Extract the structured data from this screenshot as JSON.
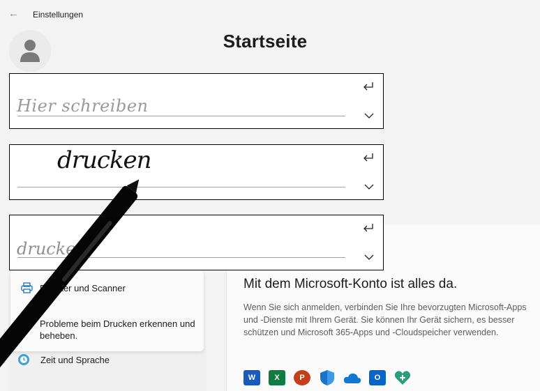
{
  "window": {
    "title": "Einstellungen"
  },
  "page": {
    "title": "Startseite"
  },
  "handwriting": {
    "placeholder": "Hier schreiben",
    "ink_text": "drucken",
    "suggestion": "drucken"
  },
  "nav_popup": {
    "items": [
      {
        "label": "Drucker und Scanner",
        "icon": "printer-icon"
      },
      {
        "label": "Probleme beim Drucken erkennen und beheben.",
        "icon": "troubleshoot-icon"
      }
    ]
  },
  "sidebar": {
    "items": [
      {
        "label": "Zeit und Sprache",
        "icon": "clock-globe-icon"
      }
    ]
  },
  "promo": {
    "title": "Mit dem Microsoft-Konto ist alles da.",
    "text": "Wenn Sie sich anmelden, verbinden Sie Ihre bevorzugten Microsoft-Apps und -Dienste mit Ihrem Gerät. Sie können Ihr Gerät sichern, es besser schützen und Microsoft 365-Apps und -Cloudspeicher verwenden.",
    "apps": [
      {
        "name": "word-icon",
        "letter": "W",
        "color": "#185abd"
      },
      {
        "name": "excel-icon",
        "letter": "X",
        "color": "#107c41"
      },
      {
        "name": "powerpoint-icon",
        "letter": "P",
        "color": "#c43e1c"
      },
      {
        "name": "defender-icon",
        "letter": "",
        "color": "#1a73c8"
      },
      {
        "name": "onedrive-icon",
        "letter": "",
        "color": "#0f78d4"
      },
      {
        "name": "outlook-icon",
        "letter": "O",
        "color": "#0a64c8"
      },
      {
        "name": "family-icon",
        "letter": "",
        "color": "#2a9d7c"
      }
    ]
  }
}
